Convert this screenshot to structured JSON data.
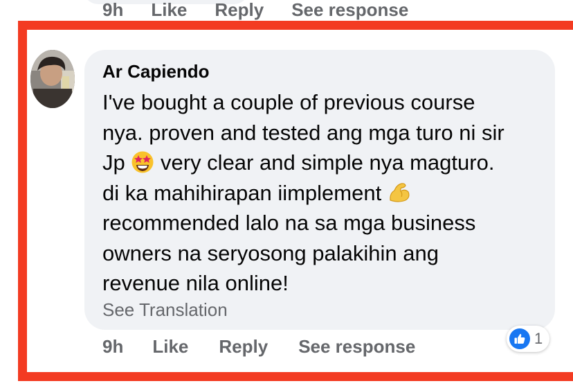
{
  "previous_comment": {
    "time": "9h",
    "like_label": "Like",
    "reply_label": "Reply",
    "see_response_label": "See response"
  },
  "comment": {
    "author": "Ar Capiendo",
    "lines": [
      "I've bought a couple of previous course",
      "nya. proven and tested ang mga turo ni sir",
      "very clear and simple nya magturo.",
      "di ka mahihirapan iimplement",
      "recommended lalo na sa mga business",
      "owners na seryosong palakihin ang",
      "revenue nila online!"
    ],
    "line3_prefix": "Jp",
    "emoji_1": "star-struck-emoji",
    "emoji_2": "flexed-biceps-emoji",
    "see_translation": "See Translation",
    "time": "9h",
    "like_label": "Like",
    "reply_label": "Reply",
    "see_response_label": "See response",
    "reaction_count": "1",
    "reaction_icon": "like-icon"
  },
  "colors": {
    "highlight": "#f33b22",
    "bubble": "#f0f2f5",
    "secondary_text": "#65676b",
    "like_blue": "#1877f2"
  }
}
